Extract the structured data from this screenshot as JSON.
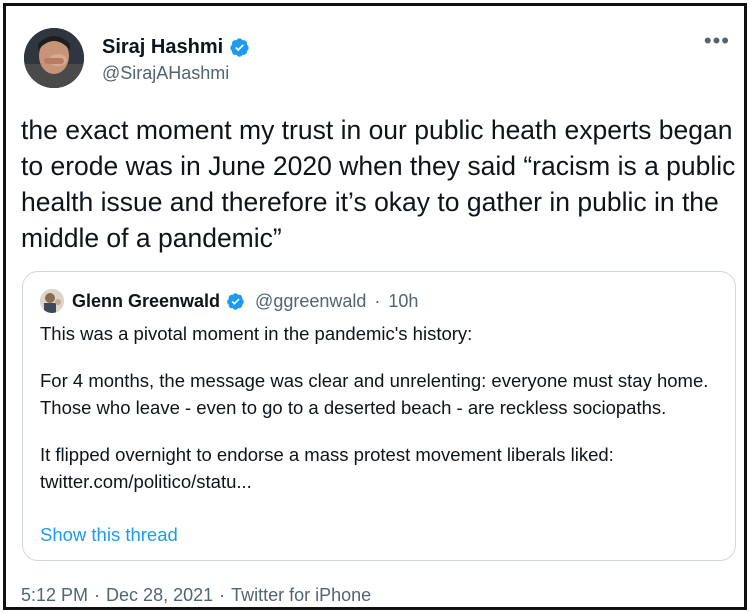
{
  "author": {
    "name": "Siraj Hashmi",
    "handle": "@SirajAHashmi"
  },
  "tweet": {
    "text": "the exact moment my trust in our public heath experts began to erode was in June 2020 when they said “racism is a public health issue and therefore it’s okay to gather in public in the middle of a pandemic”"
  },
  "quote": {
    "name": "Glenn Greenwald",
    "handle": "@ggreenwald",
    "separator": "·",
    "time": "10h",
    "paragraphs": [
      "This was a pivotal moment in the pandemic's history:",
      "For 4 months, the message was clear and unrelenting: everyone must stay home. Those who leave - even to go to a deserted beach - are reckless sociopaths.",
      "It flipped overnight to endorse a mass protest movement liberals liked:",
      "twitter.com/politico/statu..."
    ],
    "show_thread": "Show this thread"
  },
  "footer": {
    "time": "5:12 PM",
    "sep1": "·",
    "date": "Dec 28, 2021",
    "sep2": "·",
    "source": "Twitter for iPhone"
  },
  "icons": {
    "verified": "verified-badge-icon",
    "more": "more-options-icon"
  },
  "colors": {
    "accent": "#1d9bf0",
    "secondary_text": "#536471",
    "border": "#cfd9de"
  }
}
